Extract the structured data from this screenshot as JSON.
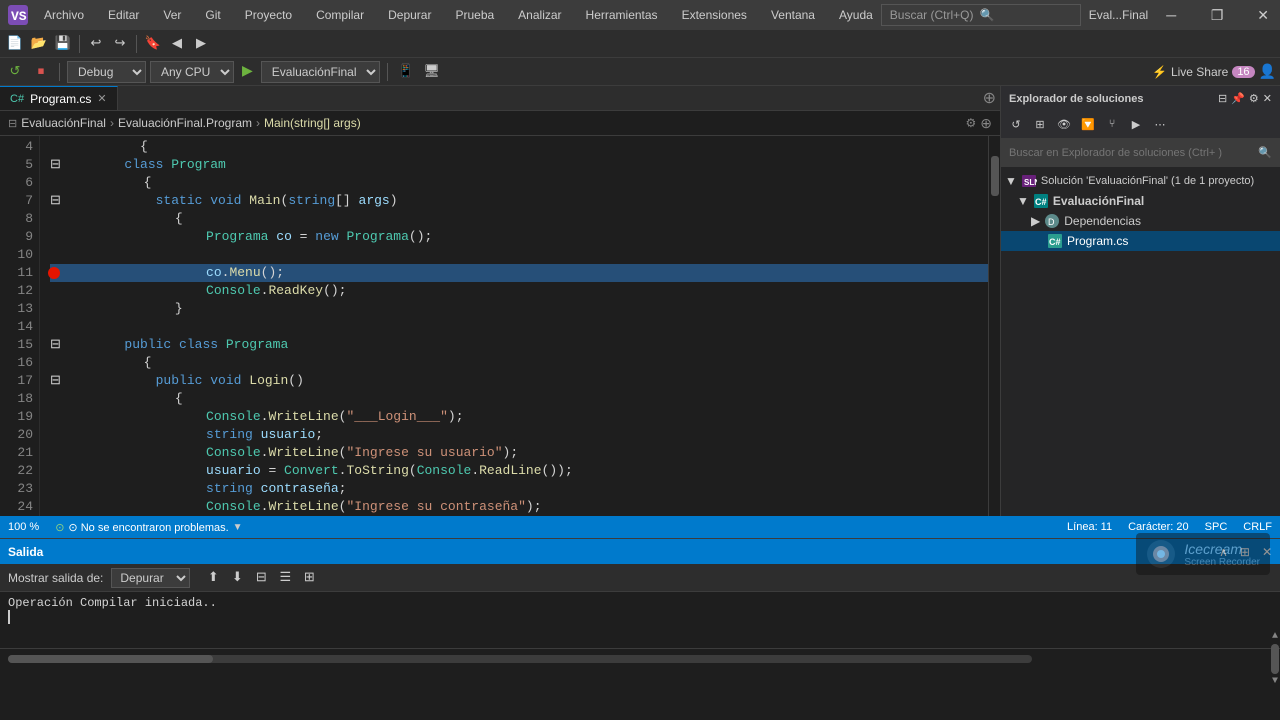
{
  "titleBar": {
    "title": "Eval...Final",
    "logo": "VS",
    "controls": [
      "─",
      "❐",
      "✕"
    ]
  },
  "menuBar": {
    "items": [
      "Archivo",
      "Editar",
      "Ver",
      "Git",
      "Proyecto",
      "Compilar",
      "Depurar",
      "Prueba",
      "Analizar",
      "Herramientas",
      "Extensiones",
      "Ventana",
      "Ayuda"
    ]
  },
  "toolbar2": {
    "debug": "Debug",
    "cpu": "Any CPU",
    "project": "EvaluaciónFinal",
    "liveShare": "⚡ Live Share"
  },
  "search": {
    "placeholder": "Buscar (Ctrl+Q)"
  },
  "breadcrumb": {
    "project": "EvaluaciónFinal",
    "file": "EvaluaciónFinal.Program",
    "method": "Main(string[] args)"
  },
  "tab": {
    "name": "Program.cs",
    "active": true
  },
  "codeLines": [
    {
      "num": 4,
      "indent": 2,
      "content": "{",
      "type": "plain"
    },
    {
      "num": 5,
      "indent": 3,
      "content": "class Program",
      "type": "class"
    },
    {
      "num": 6,
      "indent": 3,
      "content": "{",
      "type": "plain"
    },
    {
      "num": 7,
      "indent": 4,
      "content": "static void Main(string[] args)",
      "type": "method"
    },
    {
      "num": 8,
      "indent": 4,
      "content": "{",
      "type": "plain"
    },
    {
      "num": 9,
      "indent": 5,
      "content": "Programa co = new Programa();",
      "type": "code"
    },
    {
      "num": 10,
      "indent": 5,
      "content": "",
      "type": "plain"
    },
    {
      "num": 11,
      "indent": 5,
      "content": "co.Menu();",
      "type": "code",
      "active": true,
      "bp": true
    },
    {
      "num": 12,
      "indent": 5,
      "content": "Console.ReadKey();",
      "type": "code"
    },
    {
      "num": 13,
      "indent": 4,
      "content": "}",
      "type": "plain"
    },
    {
      "num": 14,
      "indent": 3,
      "content": "",
      "type": "plain"
    },
    {
      "num": 15,
      "indent": 3,
      "content": "public class Programa",
      "type": "class"
    },
    {
      "num": 16,
      "indent": 3,
      "content": "{",
      "type": "plain"
    },
    {
      "num": 17,
      "indent": 4,
      "content": "public void Login()",
      "type": "method"
    },
    {
      "num": 18,
      "indent": 4,
      "content": "{",
      "type": "plain"
    },
    {
      "num": 19,
      "indent": 5,
      "content": "Console.WriteLine(\"___Login___\");",
      "type": "code"
    },
    {
      "num": 20,
      "indent": 5,
      "content": "string usuario;",
      "type": "code"
    },
    {
      "num": 21,
      "indent": 5,
      "content": "Console.WriteLine(\"Ingrese su usuario\");",
      "type": "code"
    },
    {
      "num": 22,
      "indent": 5,
      "content": "usuario = Convert.ToString(Console.ReadLine());",
      "type": "code"
    },
    {
      "num": 23,
      "indent": 5,
      "content": "string contraseña;",
      "type": "code"
    },
    {
      "num": 24,
      "indent": 5,
      "content": "Console.WriteLine(\"Ingrese su contraseña\");",
      "type": "code"
    }
  ],
  "solutionExplorer": {
    "title": "Explorador de soluciones",
    "searchPlaceholder": "Buscar en Explorador de soluciones (Ctrl+ )",
    "tree": [
      {
        "level": 0,
        "label": "Solución 'EvaluaciónFinal' (1 de 1 proyecto)",
        "icon": "solution",
        "expanded": true
      },
      {
        "level": 1,
        "label": "EvaluaciónFinal",
        "icon": "project",
        "expanded": true
      },
      {
        "level": 2,
        "label": "Dependencias",
        "icon": "deps",
        "expanded": false
      },
      {
        "level": 2,
        "label": "Program.cs",
        "icon": "cs",
        "active": true
      }
    ]
  },
  "statusBar": {
    "zoom": "100 %",
    "status": "⊙ No se encontraron problemas.",
    "line": "Línea: 11",
    "char": "Carácter: 20",
    "encoding": "SPC",
    "lineEnding": "CRLF"
  },
  "outputPanel": {
    "title": "Salida",
    "showLabel": "Mostrar salida de:",
    "source": "Depurar",
    "lines": [
      "Operación Compilar iniciada.."
    ]
  }
}
